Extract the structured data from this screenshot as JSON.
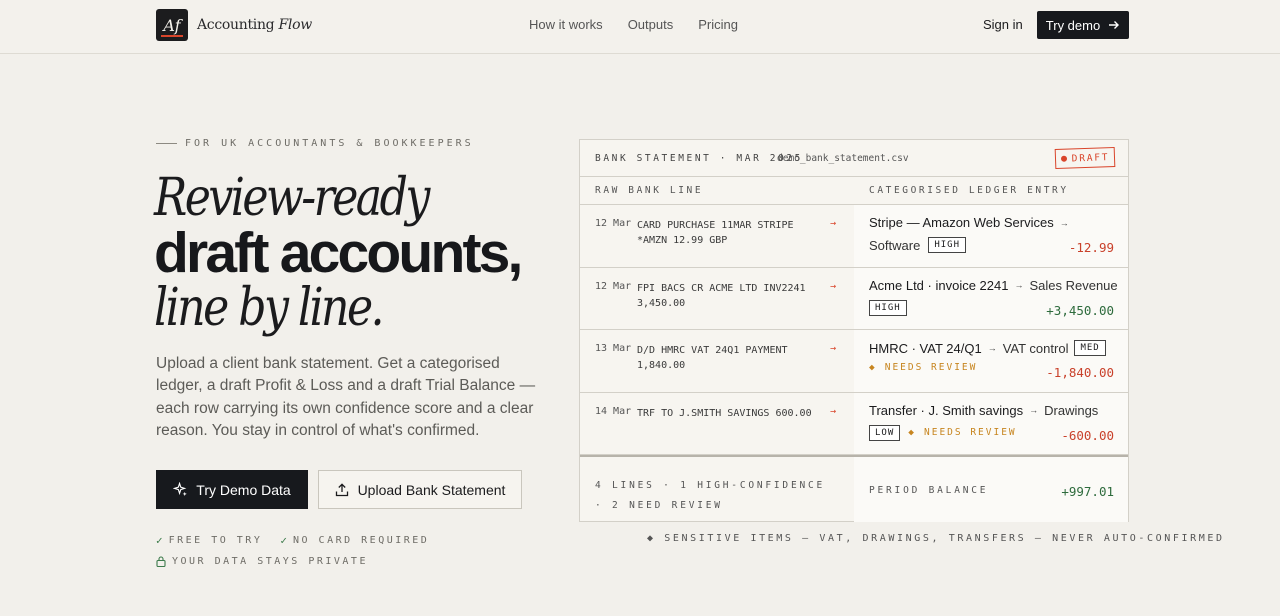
{
  "header": {
    "logo_mark": "Af",
    "brand_prefix": "Accounting",
    "brand_suffix": "Flow",
    "nav": [
      "How it works",
      "Outputs",
      "Pricing"
    ],
    "sign_in": "Sign in",
    "try_demo": "Try demo"
  },
  "hero": {
    "eyebrow": "FOR UK ACCOUNTANTS & BOOKKEEPERS",
    "title_line1": "Review-ready",
    "title_line2": "draft accounts,",
    "title_line3": "line by line.",
    "lead": "Upload a client bank statement. Get a categorised ledger, a draft Profit & Loss and a draft Trial Balance — each row carrying its own confidence score and a clear reason. You stay in control of what's confirmed.",
    "primary_button": "Try Demo Data",
    "secondary_button": "Upload Bank Statement",
    "perks": [
      "FREE TO TRY",
      "NO CARD REQUIRED",
      "YOUR DATA STAYS PRIVATE"
    ]
  },
  "card": {
    "title": "BANK STATEMENT · MAR 2025",
    "file": "demo_bank_statement.csv",
    "stamp": "DRAFT",
    "col_raw": "RAW BANK LINE",
    "col_ledger": "CATEGORISED LEDGER ENTRY",
    "rows": [
      {
        "date": "12 Mar",
        "raw": "CARD PURCHASE 11MAR STRIPE *AMZN 12.99 GBP",
        "entity": "Stripe — Amazon Web Services",
        "category": "Software",
        "confidence": "HIGH",
        "review": "",
        "amount": "-12.99"
      },
      {
        "date": "12 Mar",
        "raw": "FPI BACS CR ACME LTD INV2241 3,450.00",
        "entity": "Acme Ltd · invoice 2241",
        "category": "Sales Revenue",
        "confidence": "HIGH",
        "review": "",
        "amount": "+3,450.00"
      },
      {
        "date": "13 Mar",
        "raw": "D/D HMRC VAT 24Q1 PAYMENT 1,840.00",
        "entity": "HMRC · VAT 24/Q1",
        "category": "VAT control",
        "confidence": "MED",
        "review": "NEEDS REVIEW",
        "amount": "-1,840.00"
      },
      {
        "date": "14 Mar",
        "raw": "TRF TO J.SMITH SAVINGS 600.00",
        "entity": "Transfer · J. Smith savings",
        "category": "Drawings",
        "confidence": "LOW",
        "review": "NEEDS REVIEW",
        "amount": "-600.00"
      }
    ],
    "summary": "4 LINES · 1 HIGH-CONFIDENCE · 2 NEED REVIEW",
    "period_balance_label": "PERIOD BALANCE",
    "period_balance": "+997.01"
  },
  "footnote": "◆ SENSITIVE ITEMS — VAT, DRAWINGS, TRANSFERS — NEVER AUTO-CONFIRMED",
  "colors": {
    "accent_red": "#d9452b",
    "dark": "#17191d",
    "review_amber": "#c7851f",
    "positive_green": "#2e6b3d"
  }
}
